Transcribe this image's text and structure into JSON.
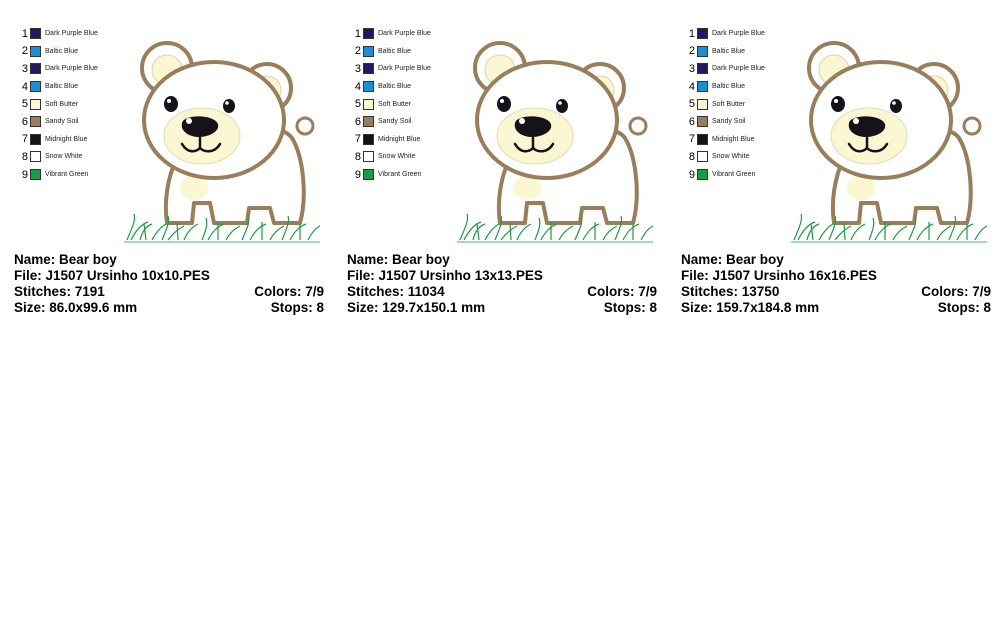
{
  "colors": [
    {
      "num": "1",
      "name": "Dark Purple Blue",
      "hex": "#24175f"
    },
    {
      "num": "2",
      "name": "Baltic Blue",
      "hex": "#1a8fd6"
    },
    {
      "num": "3",
      "name": "Dark Purple Blue",
      "hex": "#24175f"
    },
    {
      "num": "4",
      "name": "Baltic Blue",
      "hex": "#1a8fd6"
    },
    {
      "num": "5",
      "name": "Soft Butter",
      "hex": "#fbf7d2"
    },
    {
      "num": "6",
      "name": "Sandy Soil",
      "hex": "#9a7d5a"
    },
    {
      "num": "7",
      "name": "Midnight Blue",
      "hex": "#15121a"
    },
    {
      "num": "8",
      "name": "Snow White",
      "hex": "#ffffff"
    },
    {
      "num": "9",
      "name": "Vibrant Green",
      "hex": "#1c9a45"
    }
  ],
  "labels": {
    "name": "Name:",
    "file": "File:",
    "stitches": "Stitches:",
    "colors": "Colors:",
    "size": "Size:",
    "stops": "Stops:"
  },
  "designs": [
    {
      "name": "Bear boy",
      "file": "J1507 Ursinho 10x10.PES",
      "stitches": "7191",
      "colors": "7/9",
      "size": "86.0x99.6 mm",
      "stops": "8"
    },
    {
      "name": "Bear boy",
      "file": "J1507 Ursinho 13x13.PES",
      "stitches": "11034",
      "colors": "7/9",
      "size": "129.7x150.1 mm",
      "stops": "8"
    },
    {
      "name": "Bear boy",
      "file": "J1507 Ursinho 16x16.PES",
      "stitches": "13750",
      "colors": "7/9",
      "size": "159.7x184.8 mm",
      "stops": "8"
    }
  ],
  "palette": {
    "outline": "#9a7d5a",
    "fill": "#fbf7d2",
    "eyes": "#15121a",
    "grass": "#1c9a45"
  }
}
